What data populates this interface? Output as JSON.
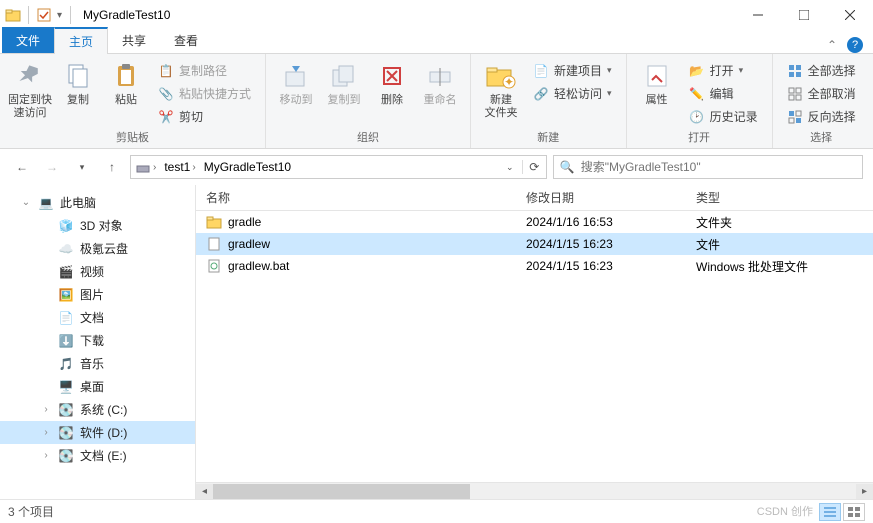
{
  "titlebar": {
    "title": "MyGradleTest10"
  },
  "tabs": {
    "file": "文件",
    "home": "主页",
    "share": "共享",
    "view": "查看"
  },
  "ribbon": {
    "pin": "固定到快\n速访问",
    "copy": "复制",
    "paste": "粘贴",
    "copypath": "复制路径",
    "pasteshortcut": "粘贴快捷方式",
    "cut": "剪切",
    "g1": "剪贴板",
    "moveto": "移动到",
    "copyto": "复制到",
    "delete": "删除",
    "rename": "重命名",
    "g2": "组织",
    "newfolder": "新建\n文件夹",
    "newitem": "新建项目",
    "easyaccess": "轻松访问",
    "g3": "新建",
    "properties": "属性",
    "open": "打开",
    "edit": "编辑",
    "history": "历史记录",
    "g4": "打开",
    "selectall": "全部选择",
    "selectnone": "全部取消",
    "invert": "反向选择",
    "g5": "选择"
  },
  "breadcrumb": {
    "seg1": "test1",
    "seg2": "MyGradleTest10"
  },
  "search": {
    "placeholder": "搜索\"MyGradleTest10\""
  },
  "nav": {
    "thispc": "此电脑",
    "obj3d": "3D 对象",
    "jiyun": "极氪云盘",
    "video": "视频",
    "pictures": "图片",
    "documents": "文档",
    "downloads": "下载",
    "music": "音乐",
    "desktop": "桌面",
    "cdrive": "系统 (C:)",
    "ddrive": "软件 (D:)",
    "edrive": "文档 (E:)"
  },
  "columns": {
    "name": "名称",
    "date": "修改日期",
    "type": "类型"
  },
  "files": [
    {
      "name": "gradle",
      "date": "2024/1/16 16:53",
      "type": "文件夹",
      "icon": "folder"
    },
    {
      "name": "gradlew",
      "date": "2024/1/15 16:23",
      "type": "文件",
      "icon": "file",
      "selected": true
    },
    {
      "name": "gradlew.bat",
      "date": "2024/1/15 16:23",
      "type": "Windows 批处理文件",
      "icon": "bat"
    }
  ],
  "status": {
    "count": "3 个项目"
  },
  "watermark": "CSDN 创作"
}
